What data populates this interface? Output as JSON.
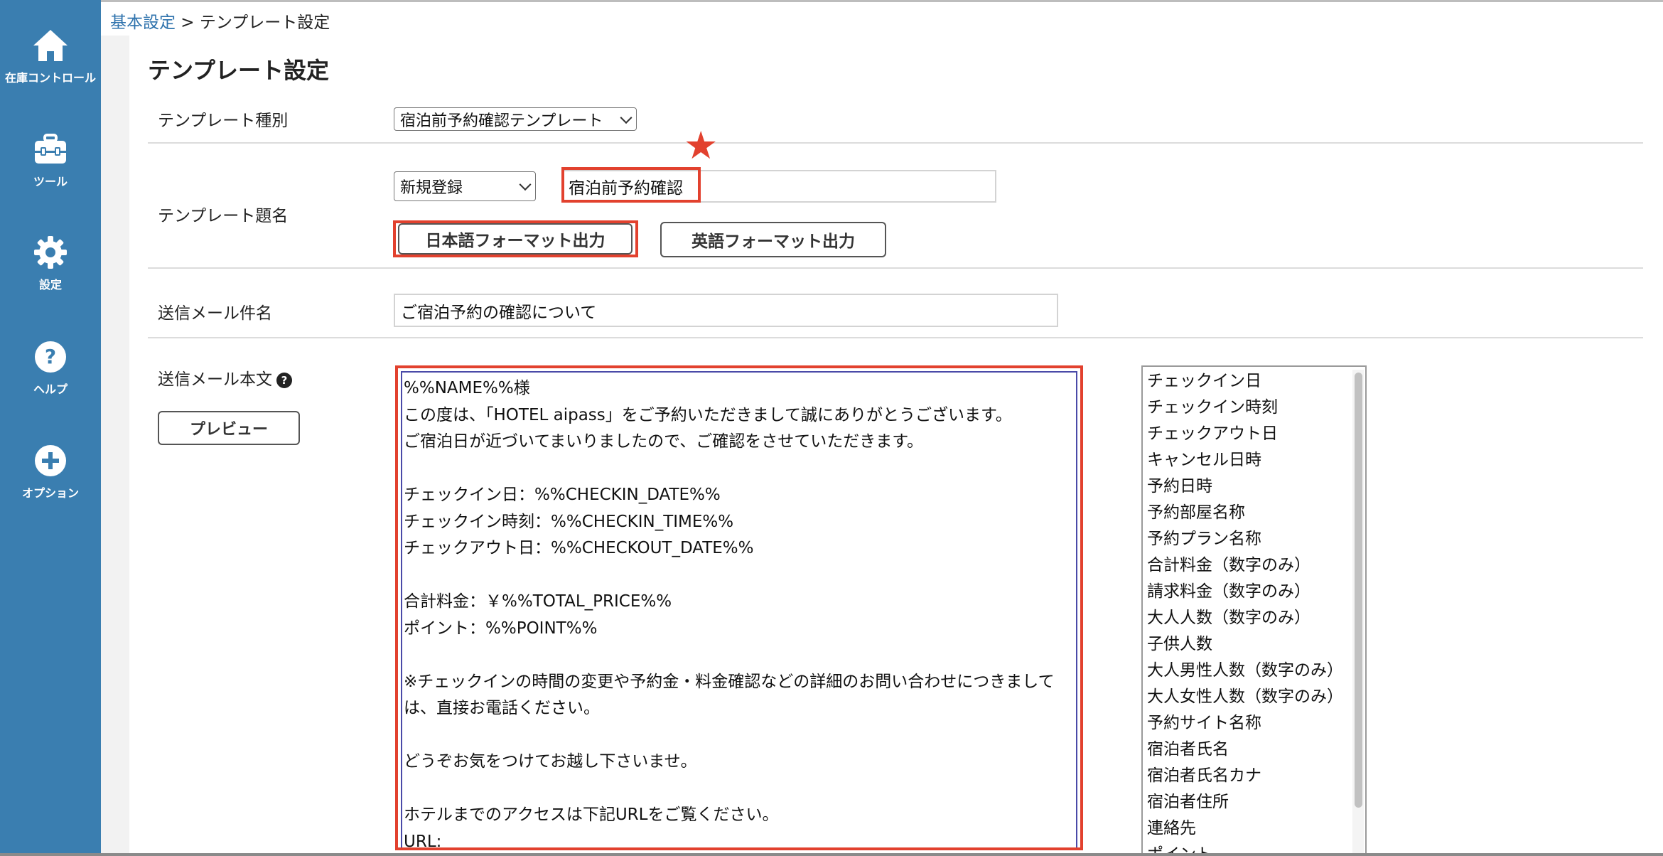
{
  "sidebar": {
    "items": [
      {
        "label": "在庫コントロール",
        "icon": "home-icon"
      },
      {
        "label": "ツール",
        "icon": "toolbox-icon"
      },
      {
        "label": "設定",
        "icon": "gear-icon"
      },
      {
        "label": "ヘルプ",
        "icon": "help-circle-icon"
      },
      {
        "label": "オプション",
        "icon": "plus-circle-icon"
      }
    ]
  },
  "breadcrumb": {
    "link": "基本設定",
    "separator": " > ",
    "current": "テンプレート設定"
  },
  "page_title": "テンプレート設定",
  "form": {
    "template_type": {
      "label": "テンプレート種別",
      "selected": "宿泊前予約確認テンプレート"
    },
    "template_name": {
      "label": "テンプレート題名",
      "mode_selected": "新規登録",
      "name_value": "宿泊前予約確認",
      "japanese_button": "日本語フォーマット出力",
      "english_button": "英語フォーマット出力"
    },
    "mail_subject": {
      "label": "送信メール件名",
      "value": "ご宿泊予約の確認について"
    },
    "mail_body": {
      "label": "送信メール本文",
      "help": "?",
      "preview_button": "プレビュー",
      "value": "%%NAME%%様\nこの度は、「HOTEL aipass」をご予約いただきまして誠にありがとうございます。\nご宿泊日が近づいてまいりましたので、ご確認をさせていただきます。\n\nチェックイン日：%%CHECKIN_DATE%%\nチェックイン時刻：%%CHECKIN_TIME%%\nチェックアウト日：%%CHECKOUT_DATE%%\n\n合計料金：￥%%TOTAL_PRICE%%\nポイント：%%POINT%%\n\n※チェックインの時間の変更や予約金・料金確認などの詳細のお問い合わせにつきまして\nは、直接お電話ください。\n\nどうぞお気をつけてお越し下さいませ。\n\nホテルまでのアクセスは下記URLをご覧ください。\nURL:"
    },
    "variables": [
      "チェックイン日",
      "チェックイン時刻",
      "チェックアウト日",
      "キャンセル日時",
      "予約日時",
      "予約部屋名称",
      "予約プラン名称",
      "合計料金（数字のみ）",
      "請求料金（数字のみ）",
      "大人人数（数字のみ）",
      "子供人数",
      "大人男性人数（数字のみ）",
      "大人女性人数（数字のみ）",
      "予約サイト名称",
      "宿泊者氏名",
      "宿泊者氏名カナ",
      "宿泊者住所",
      "連絡先",
      "ポイント"
    ]
  },
  "colors": {
    "sidebar": "#3a7eb0",
    "highlight": "#e2412e",
    "link": "#2f73ad"
  }
}
